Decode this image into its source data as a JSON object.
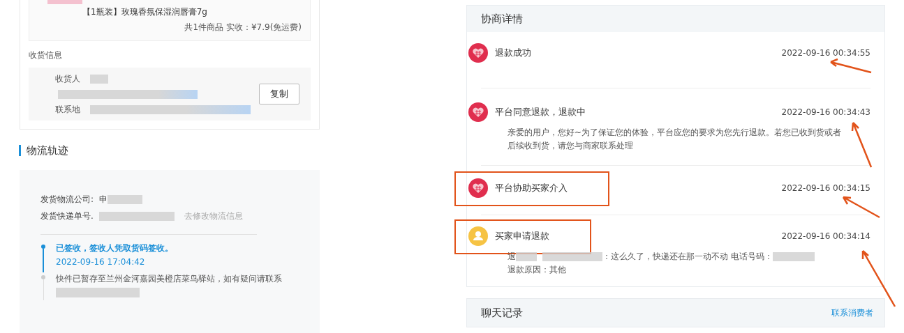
{
  "order": {
    "product_name": "【1瓶装】玫瑰香氛保湿润唇膏7g",
    "summary": "共1件商品  实收：¥7.9(免运费)",
    "receiver_title": "收货信息",
    "receiver_labels": [
      "收货人",
      "联系地"
    ],
    "copy_button": "复制"
  },
  "logistics": {
    "title": "物流轨迹",
    "company_label": "发货物流公司:",
    "company_value": "申",
    "number_label": "发货快递单号.",
    "edit_link": "去修改物流信息",
    "track": [
      {
        "text": "已签收，签收人凭取货码签收。",
        "time": "2022-09-16 17:04:42",
        "selected": true
      },
      {
        "text": "快件已暂存至兰州金河嘉园美橙店菜鸟驿站，如有疑问请联系",
        "selected": false
      }
    ]
  },
  "negotiation": {
    "title": "协商详情",
    "events": [
      {
        "kind": "platform",
        "title": "退款成功",
        "time": "2022-09-16 00:34:55",
        "highlighted": false
      },
      {
        "kind": "platform",
        "title": "平台同意退款，退款中",
        "time": "2022-09-16 00:34:43",
        "lines": [
          "亲爱的用户，您好~为了保证您的体验，平台应您的要求为您先行退款。若您已收到货或者",
          "后续收到货，请您与商家联系处理"
        ],
        "highlighted": false
      },
      {
        "kind": "platform",
        "title": "平台协助买家介入",
        "time": "2022-09-16 00:34:15",
        "highlighted": true
      },
      {
        "kind": "buyer",
        "title": "买家申请退款",
        "time": "2022-09-16 00:34:14",
        "reason_prefix": "退",
        "reason_text": "：这么久了，快递还在那一动不动 电话号码：",
        "lines": [
          "退款原因：其他"
        ],
        "highlighted": true
      }
    ]
  },
  "chat": {
    "title": "聊天记录",
    "link": "联系消费者"
  }
}
